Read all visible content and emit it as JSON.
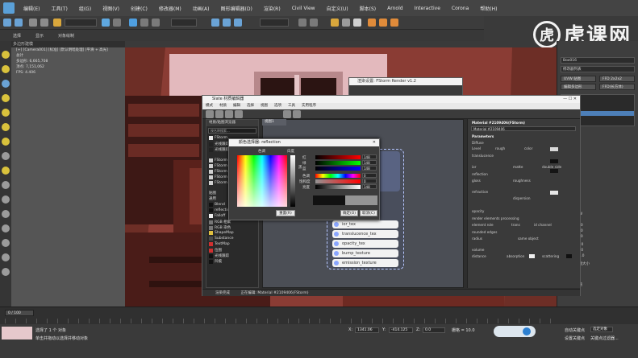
{
  "menubar": {
    "items": [
      "编辑(E)",
      "工具(T)",
      "组(G)",
      "视图(V)",
      "创建(C)",
      "修改器(M)",
      "动画(A)",
      "图形编辑器(D)",
      "渲染(R)",
      "Civil View",
      "自定义(U)",
      "脚本(S)",
      "Arnold",
      "Interactive",
      "Corona",
      "帮助(H)"
    ]
  },
  "watermark": {
    "logo_text": "虎课网"
  },
  "toolbar2": {
    "items": [
      "选择",
      "显示",
      "对象绘制"
    ]
  },
  "ribbon": {
    "label": "多边形建模"
  },
  "viewport": {
    "label": "[+] [Camera001] [标准] [默认明暗处理] [平滑 + 高光]",
    "stats": [
      "总计",
      "多边形: 6,665,708",
      "顶点: 7,151,062",
      "FPS: 4.406"
    ]
  },
  "right_panel": {
    "object_name": "Box016",
    "modifier_list": "修改器列表",
    "buttons": [
      "UVW 贴图",
      "FFD 2x2x2",
      "编辑多边形",
      "FFD(长方体)"
    ],
    "rows": [
      "平面",
      "柱形",
      "球形",
      "收缩包裹",
      "长方体",
      "面",
      "XYZ 到 UVW",
      "长度: 1000.0",
      "宽度: 1000.0",
      "高度: 1000.0",
      "U 向平铺: 1.0",
      "V 向平铺: 1.0",
      "W 向平铺: 1.0",
      "真实世界贴图大小",
      "通道:",
      "贴图通道: 1",
      "顶点颜色通道"
    ]
  },
  "fstorm_dialog": {
    "title": "渲染设置: FStorm Render v1.2"
  },
  "slate": {
    "title": "Slate 材质编辑器",
    "menu": [
      "模式",
      "材质",
      "编辑",
      "选择",
      "视图",
      "选项",
      "工具",
      "实用程序"
    ],
    "browser_head": "材质/贴图浏览器",
    "browser_search": "按名称搜索...",
    "browser_items": [
      "FStorm",
      "光线跟踪",
      "光线跟踪",
      "FStorm",
      "FStorm",
      "FStorm",
      "FStorm",
      "FStorm",
      "贴图",
      "通用",
      "Blend",
      "reflection",
      "Falloff",
      "RGB 相乘",
      "RGB 染色",
      "ShapeMap",
      "Substance",
      "TextMap",
      "位图",
      "光线跟踪",
      "凹痕"
    ],
    "view_tab": "视图1",
    "node_slots": [
      "ior_tex",
      "translucence_tex",
      "opacity_tex",
      "bump_texture",
      "emission_texture"
    ],
    "status": "渲染完成",
    "status_material": "正在编辑: Material #2109406(FStorm)",
    "params": {
      "title": "Material #2109406(FStorm)",
      "subtitle": "Material #2109406",
      "section": "Parameters",
      "rows": [
        "Diffuse",
        "Level",
        "rough",
        "color",
        "translucence",
        "ior",
        "matte",
        "double side",
        "reflection",
        "gloss",
        "roughness",
        "refraction",
        "dispersion",
        "opacity",
        "render elements processing",
        "element role",
        "trans",
        "id channel",
        "rounded edges",
        "radius",
        "same object",
        "volume",
        "distance",
        "absorption",
        "scattering"
      ]
    }
  },
  "picker": {
    "title": "颜色选择器: reflection",
    "hue_label": "色调",
    "white_label": "白度",
    "black_label": "黑",
    "channels": [
      "红",
      "绿",
      "蓝",
      "色调",
      "饱和度",
      "亮度"
    ],
    "channel_values": [
      "148",
      "148",
      "148",
      "0",
      "0",
      "148"
    ],
    "reset_label": "重置(R)",
    "ok_label": "确定(O)",
    "cancel_label": "取消(C)",
    "swatch_color": "#949494"
  },
  "timeline": {
    "frame": "0 / 100"
  },
  "statusbar": {
    "selection": "选择了 1 个 对象",
    "hint": "单击并拖动以选择并移动对象",
    "x_label": "X:",
    "x_value": "1341.06",
    "y_label": "Y:",
    "y_value": "-414.125",
    "z_label": "Z:",
    "z_value": "0.0",
    "grid": "栅格 = 10.0",
    "autokey": "自动关键点",
    "setkey": "设置关键点",
    "selected": "选定对象",
    "filter": "关键点过滤器..."
  },
  "colors": {
    "render_bg": "#6d2e26",
    "accent_blue": "#5aa0d8"
  }
}
